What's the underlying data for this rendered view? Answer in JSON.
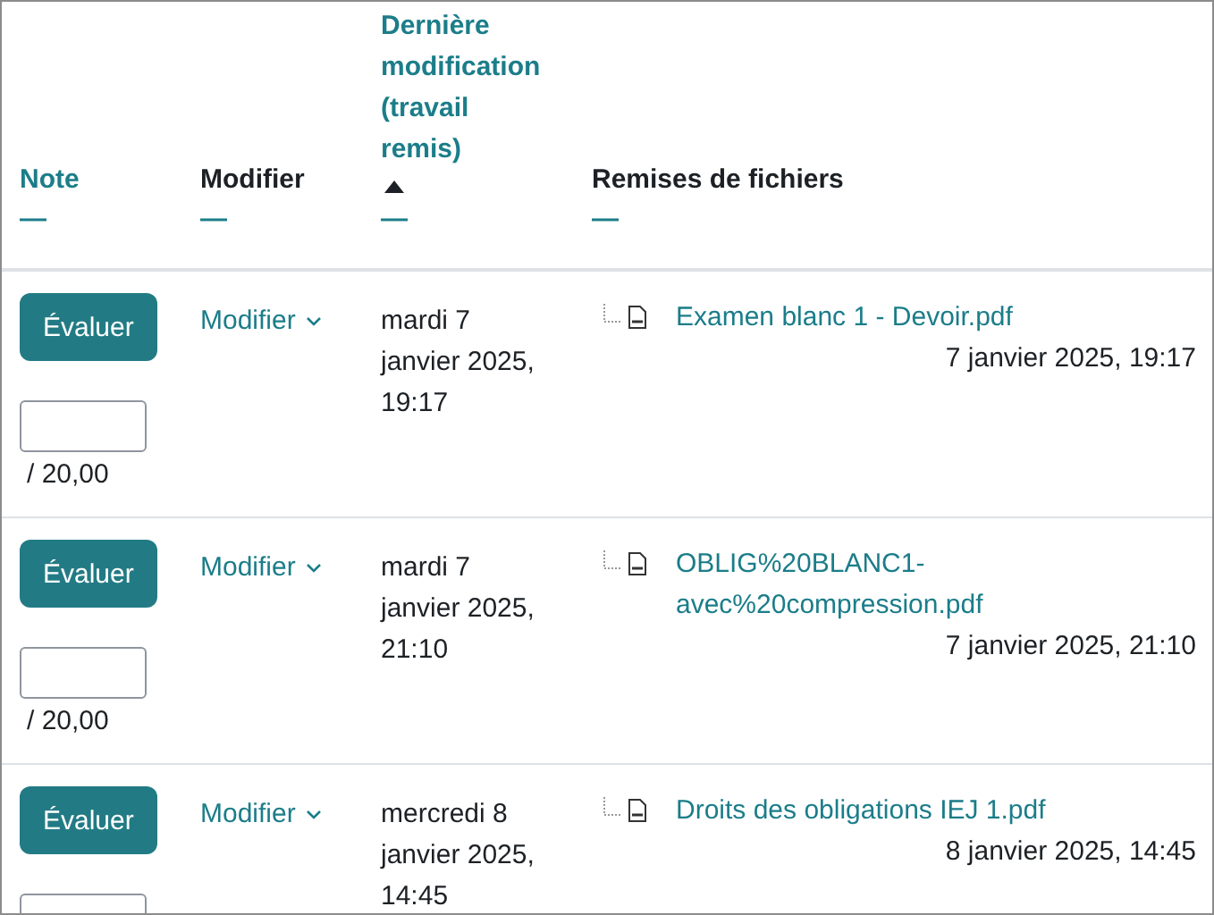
{
  "columns": [
    {
      "label": "Note",
      "kind": "link",
      "sorted_ascending": false,
      "collapse": "—"
    },
    {
      "label": "Modifier",
      "kind": "plain",
      "sorted_ascending": false,
      "collapse": "—"
    },
    {
      "label": "Dernière modification (travail remis)",
      "kind": "link",
      "sorted_ascending": true,
      "collapse": "—"
    },
    {
      "label": "Remises de fichiers",
      "kind": "plain",
      "sorted_ascending": false,
      "collapse": "—"
    }
  ],
  "rows": [
    {
      "grade_button": "Évaluer",
      "grade_max": "/ 20,00",
      "action": "Modifier",
      "modified": "mardi 7 janvier 2025, 19:17",
      "files": [
        {
          "name": "Examen blanc 1 - Devoir.pdf",
          "date": "7 janvier 2025, 19:17"
        }
      ]
    },
    {
      "grade_button": "Évaluer",
      "grade_max": "/ 20,00",
      "action": "Modifier",
      "modified": "mardi 7 janvier 2025, 21:10",
      "files": [
        {
          "name": "OBLIG%20BLANC1-avec%20compression.pdf",
          "date": "7 janvier 2025, 21:10"
        }
      ]
    },
    {
      "grade_button": "Évaluer",
      "action": "Modifier",
      "modified": "mercredi 8 janvier 2025, 14:45",
      "files": [
        {
          "name": "Droits des obligations IEJ 1.pdf",
          "date": "8 janvier 2025, 14:45"
        }
      ]
    }
  ]
}
